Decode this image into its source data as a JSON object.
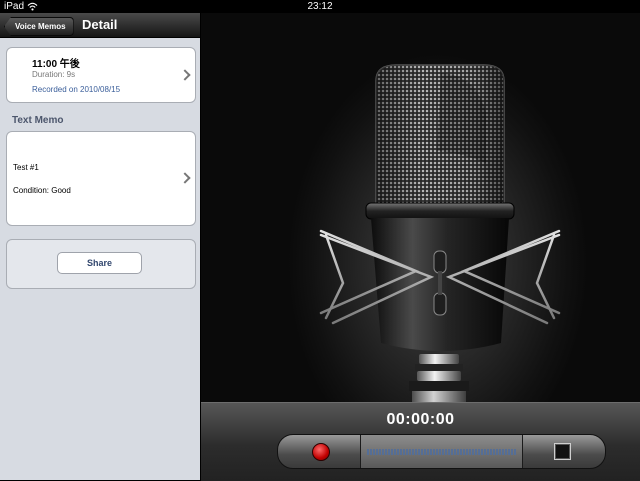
{
  "status_bar": {
    "carrier": "iPad",
    "time": "23:12"
  },
  "nav": {
    "back_label": "Voice Memos",
    "title": "Detail"
  },
  "recording": {
    "time": "11:00 午後",
    "duration": "Duration:  9s",
    "recorded_on": "Recorded on 2010/08/15"
  },
  "text_memo": {
    "header": "Text Memo",
    "line1": "Test #1",
    "line2": "Condition: Good"
  },
  "share": {
    "label": "Share"
  },
  "recorder": {
    "timer": "00:00:00"
  },
  "colors": {
    "record": "#c00000",
    "link": "#3a5e9a",
    "nav_bg": "#1f1f1f"
  },
  "icons": [
    "wifi-icon",
    "chevron-right-icon",
    "microphone-image",
    "record-icon",
    "stop-icon"
  ]
}
